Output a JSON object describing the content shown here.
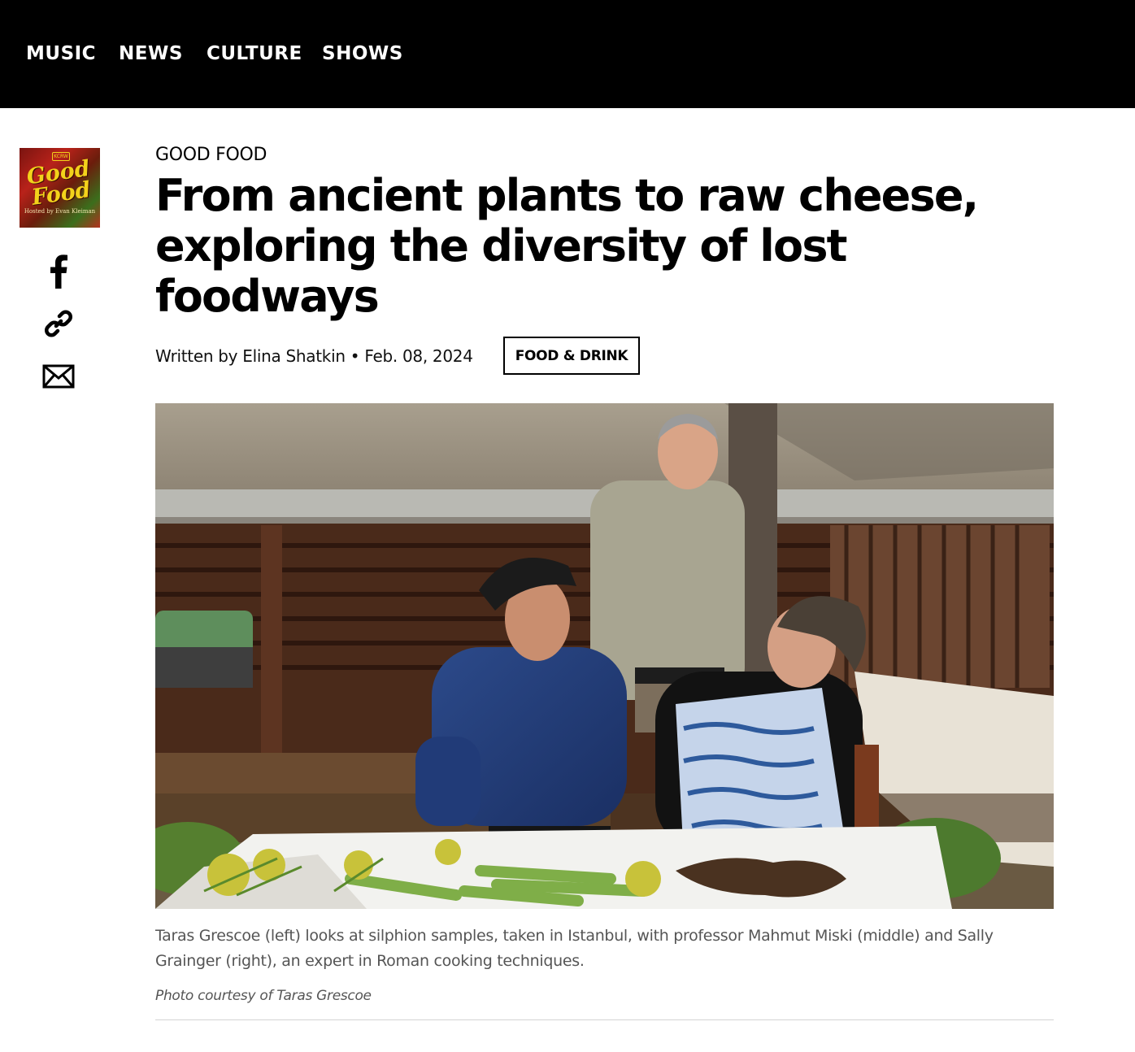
{
  "nav": {
    "items": [
      {
        "label": "MUSIC"
      },
      {
        "label": "NEWS"
      },
      {
        "label": "CULTURE"
      },
      {
        "label": "SHOWS"
      }
    ]
  },
  "show_logo": {
    "title_line1": "Good",
    "title_line2": "Food",
    "badge": "KCRW",
    "subtitle": "Hosted by Evan Kleiman"
  },
  "share": {
    "icons": [
      "facebook-icon",
      "link-icon",
      "email-icon"
    ]
  },
  "article": {
    "kicker": "GOOD FOOD",
    "headline": "From ancient plants to raw cheese, exploring the diversity of lost foodways",
    "byline_prefix": "Written by ",
    "author": "Elina Shatkin",
    "separator": " • ",
    "date": "Feb. 08, 2024",
    "tag": "FOOD & DRINK"
  },
  "image": {
    "caption": "Taras Grescoe (left) looks at silphion samples, taken in Istanbul, with professor Mahmut Miski (middle) and Sally Grainger (right), an expert in Roman cooking techniques.",
    "credit": "Photo courtesy of Taras Grescoe"
  },
  "colors": {
    "nav_background": "#000000",
    "nav_text": "#ffffff",
    "caption_text": "#555555",
    "divider": "#d4d4d4"
  }
}
